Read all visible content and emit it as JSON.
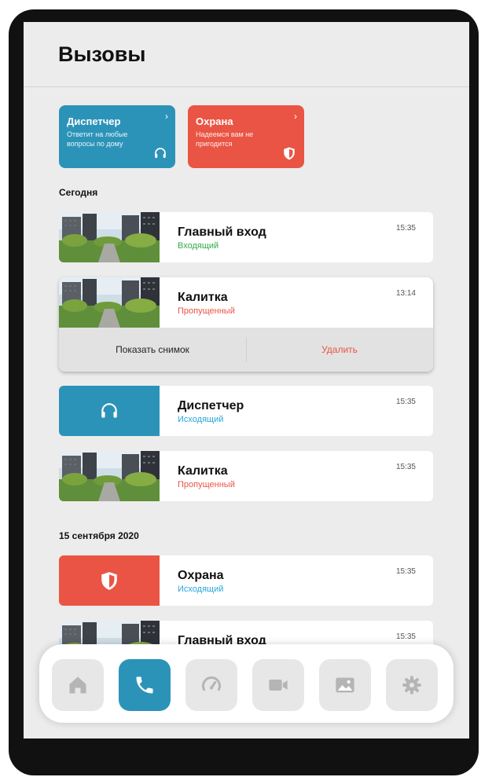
{
  "page": {
    "title": "Вызовы"
  },
  "quick": [
    {
      "title": "Диспетчер",
      "subtitle": "Ответит на любые вопросы по дому",
      "arrow": "›",
      "icon": "headset-icon",
      "color": "#2c93b8"
    },
    {
      "title": "Охрана",
      "subtitle": "Надеемся вам не пригодится",
      "arrow": "›",
      "icon": "shield-icon",
      "color": "#ea5444"
    }
  ],
  "sections": [
    "Сегодня",
    "15 сентября 2020"
  ],
  "calls": [
    {
      "name": "Главный вход",
      "status": "Входящий",
      "time": "15:35",
      "thumb": "photo"
    },
    {
      "name": "Калитка",
      "status": "Пропущенный",
      "time": "13:14",
      "thumb": "photo"
    },
    {
      "name": "Диспетчер",
      "status": "Исходящий",
      "time": "15:35",
      "thumb": "headset-icon"
    },
    {
      "name": "Калитка",
      "status": "Пропущенный",
      "time": "15:35",
      "thumb": "photo"
    },
    {
      "name": "Охрана",
      "status": "Исходящий",
      "time": "15:35",
      "thumb": "shield-icon"
    },
    {
      "name": "Главный вход",
      "status": "",
      "time": "15:35",
      "thumb": "photo"
    }
  ],
  "actions": {
    "show": "Показать снимок",
    "delete": "Удалить"
  },
  "nav": [
    {
      "icon": "home-icon",
      "active": false
    },
    {
      "icon": "phone-icon",
      "active": true
    },
    {
      "icon": "gauge-icon",
      "active": false
    },
    {
      "icon": "video-camera-icon",
      "active": false
    },
    {
      "icon": "gallery-icon",
      "active": false
    },
    {
      "icon": "gear-icon",
      "active": false
    }
  ],
  "colors": {
    "accent": "#2c93b8",
    "alarm": "#ea5444",
    "incoming": "#33a94a",
    "outgoing": "#2aa6d9",
    "missed": "#ea5444"
  }
}
